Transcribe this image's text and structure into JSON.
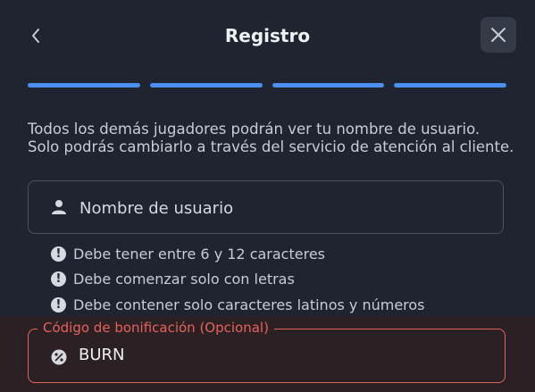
{
  "header": {
    "title": "Registro",
    "back_icon": "chevron-left-icon",
    "close_icon": "close-icon"
  },
  "progress": {
    "steps_total": 4,
    "steps_completed": 4,
    "color": "#4b8ff0"
  },
  "description": {
    "line1": "Todos los demás jugadores podrán ver tu nombre de usuario.",
    "line2": "Solo podrás cambiarlo a través del servicio de atención al cliente."
  },
  "username_field": {
    "icon": "user-icon",
    "placeholder": "Nombre de usuario"
  },
  "rules": [
    {
      "icon": "exclamation-icon",
      "text": "Debe tener entre 6 y 12 caracteres"
    },
    {
      "icon": "exclamation-icon",
      "text": "Debe comenzar solo con letras"
    },
    {
      "icon": "exclamation-icon",
      "text": "Debe contener solo caracteres latinos y números"
    }
  ],
  "bonus_field": {
    "label": "Código de bonificación (Opcional)",
    "icon": "percent-icon",
    "value": "BURN",
    "border_color": "#e8625c"
  }
}
